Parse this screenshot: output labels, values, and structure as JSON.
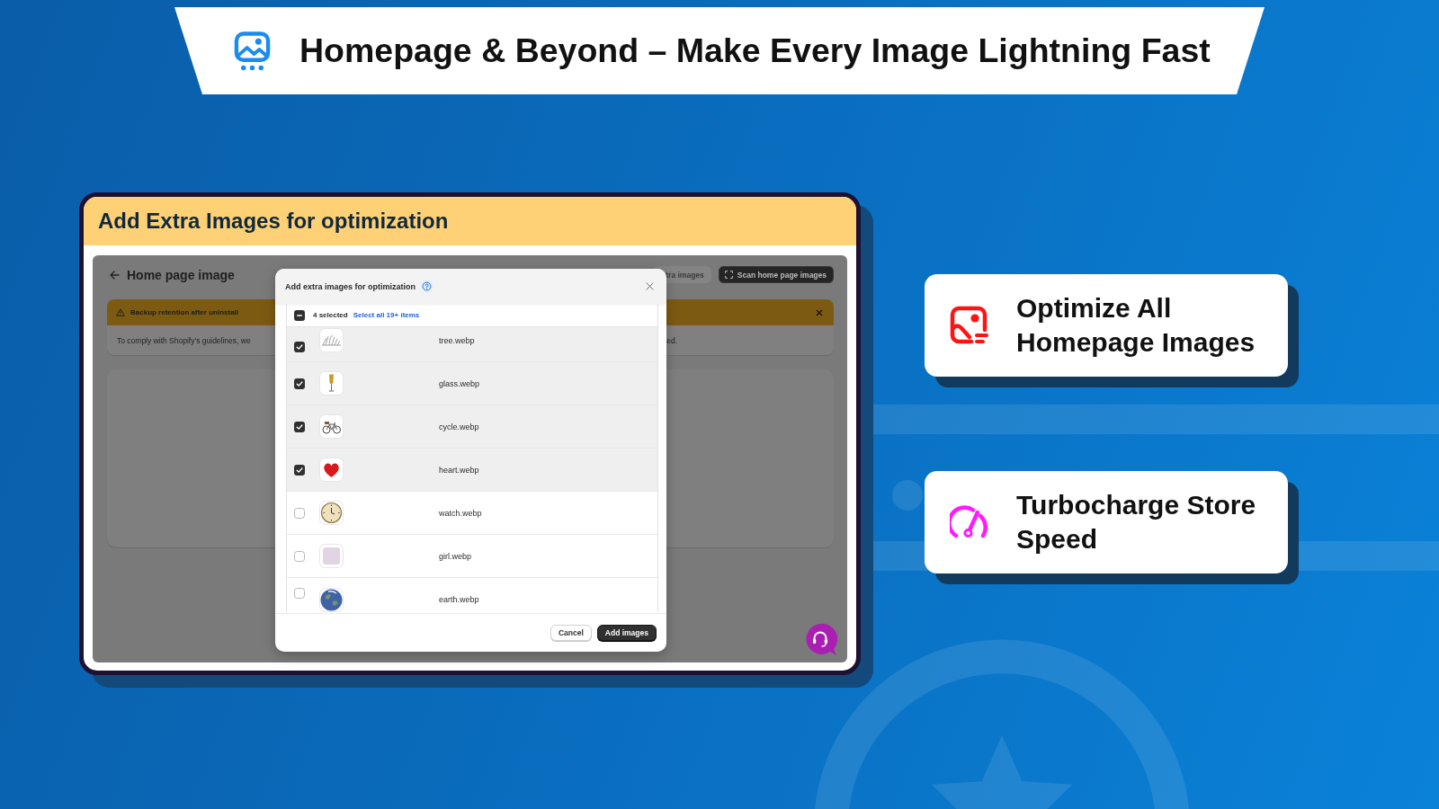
{
  "banner": {
    "title": "Homepage & Beyond – Make Every Image Lightning Fast"
  },
  "showcase": {
    "title": "Add Extra Images for optimization",
    "app": {
      "page_title": "Home page image",
      "buttons": [
        {
          "label": "tra images",
          "kind": "secondary"
        },
        {
          "label": "Scan home page images",
          "kind": "primary"
        }
      ],
      "notice": {
        "title": "Backup retention after uninstall",
        "body_start": "To comply with Shopify’s guidelines, we",
        "body_end": "ed."
      },
      "dialog": {
        "title": "Add extra images for optimization",
        "selection": {
          "count": "4 selected",
          "link": "Select all 19+ items",
          "indeterminate": true
        },
        "rows": [
          {
            "name": "tree.webp",
            "checked": true
          },
          {
            "name": "glass.webp",
            "checked": true
          },
          {
            "name": "cycle.webp",
            "checked": true
          },
          {
            "name": "heart.webp",
            "checked": true
          },
          {
            "name": "watch.webp",
            "checked": false
          },
          {
            "name": "girl.webp",
            "checked": false
          },
          {
            "name": "earth.webp",
            "checked": false
          }
        ],
        "buttons": [
          {
            "label": "Cancel",
            "kind": "secondary"
          },
          {
            "label": "Add images",
            "kind": "primary"
          }
        ]
      }
    }
  },
  "features": [
    {
      "title": "Optimize All Homepage Images"
    },
    {
      "title": "Turbocharge Store Speed"
    }
  ]
}
